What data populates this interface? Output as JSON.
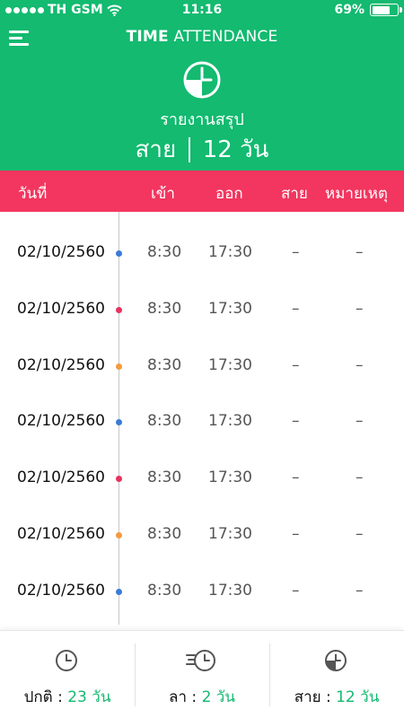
{
  "status_bar": {
    "carrier": "TH GSM",
    "time": "11:16",
    "battery": "69%"
  },
  "header": {
    "title_bold": "TIME",
    "title_rest": "ATTENDANCE",
    "report_label": "รายงานสรุป",
    "late_label": "สาย",
    "late_value": "12 วัน"
  },
  "table": {
    "columns": [
      "วันที่",
      "เข้า",
      "ออก",
      "สาย",
      "หมายเหตุ"
    ],
    "rows": [
      {
        "date": "02/10/2560",
        "in": "8:30",
        "out": "17:30",
        "late": "–",
        "note": "–",
        "dot_color": "#3a7bd5"
      },
      {
        "date": "02/10/2560",
        "in": "8:30",
        "out": "17:30",
        "late": "–",
        "note": "–",
        "dot_color": "#e8315f"
      },
      {
        "date": "02/10/2560",
        "in": "8:30",
        "out": "17:30",
        "late": "–",
        "note": "–",
        "dot_color": "#f39a3c"
      },
      {
        "date": "02/10/2560",
        "in": "8:30",
        "out": "17:30",
        "late": "–",
        "note": "–",
        "dot_color": "#3a7bd5"
      },
      {
        "date": "02/10/2560",
        "in": "8:30",
        "out": "17:30",
        "late": "–",
        "note": "–",
        "dot_color": "#e8315f"
      },
      {
        "date": "02/10/2560",
        "in": "8:30",
        "out": "17:30",
        "late": "–",
        "note": "–",
        "dot_color": "#f39a3c"
      },
      {
        "date": "02/10/2560",
        "in": "8:30",
        "out": "17:30",
        "late": "–",
        "note": "–",
        "dot_color": "#3a7bd5"
      }
    ]
  },
  "footer": {
    "normal_label": "ปกติ :",
    "normal_value": "23 วัน",
    "normal_icon": "clock-icon",
    "leave_label": "ลา :",
    "leave_value": "2 วัน",
    "leave_icon": "fast-clock-icon",
    "late_label": "สาย :",
    "late_value": "12 วัน",
    "late_icon": "clock-quarter-icon"
  },
  "colors": {
    "primary": "#13ba70",
    "table_header": "#f2365f"
  }
}
